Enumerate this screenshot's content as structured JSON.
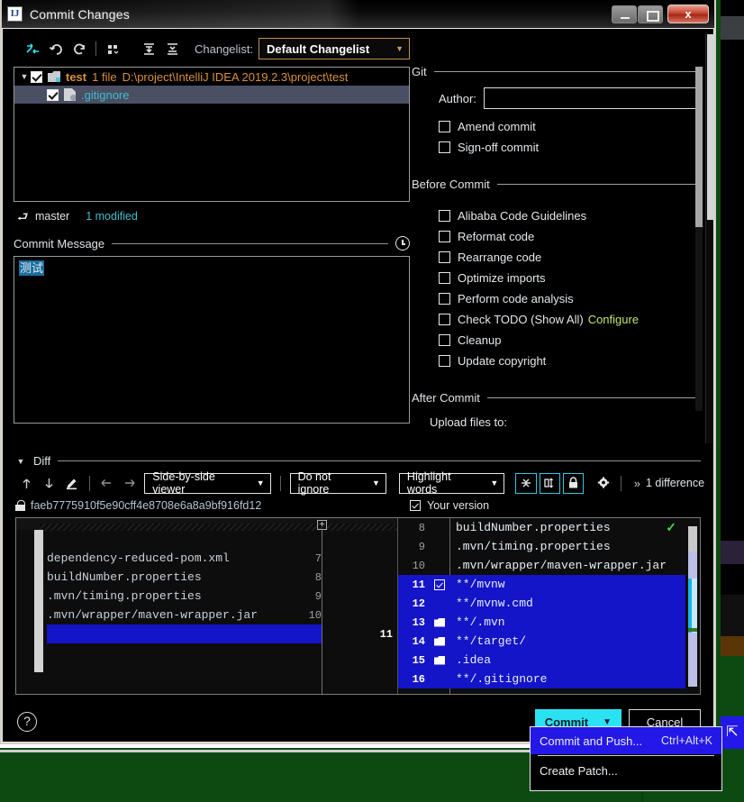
{
  "window": {
    "title": "Commit Changes",
    "app_icon": "IJ",
    "close_label": "x"
  },
  "changelist_toolbar": {
    "icons": [
      {
        "name": "move-to-another-changelist-icon",
        "glyph": "arrows"
      },
      {
        "name": "revert-icon",
        "glyph": "undo"
      },
      {
        "name": "refresh-icon",
        "glyph": "refresh"
      },
      {
        "name": "group-by-icon",
        "glyph": "group"
      },
      {
        "name": "expand-all-icon",
        "glyph": "expand"
      },
      {
        "name": "collapse-all-icon",
        "glyph": "collapse"
      }
    ],
    "changelist_label": "Changelist:",
    "changelist_value": "Default Changelist"
  },
  "file_tree": {
    "rows": [
      {
        "type": "folder",
        "expanded": true,
        "checked": true,
        "name": "test",
        "count": "1 file",
        "path": "D:\\project\\IntelliJ IDEA 2019.2.3\\project\\test",
        "selected": false
      },
      {
        "type": "file",
        "checked": true,
        "name": ".gitignore",
        "selected": true
      }
    ]
  },
  "branch_bar": {
    "branch": "master",
    "modified": "1 modified"
  },
  "commit_message": {
    "section_title": "Commit Message",
    "value": "测试",
    "history_icon": "clock-icon"
  },
  "git_group": {
    "title": "Git",
    "author_label": "Author:",
    "author_value": "",
    "options": [
      {
        "label": "Amend commit",
        "checked": false
      },
      {
        "label": "Sign-off commit",
        "checked": false
      }
    ]
  },
  "before_commit_group": {
    "title": "Before Commit",
    "options": [
      {
        "label": "Alibaba Code Guidelines",
        "checked": false
      },
      {
        "label": "Reformat code",
        "checked": false
      },
      {
        "label": "Rearrange code",
        "checked": false
      },
      {
        "label": "Optimize imports",
        "checked": false
      },
      {
        "label": "Perform code analysis",
        "checked": false
      },
      {
        "label": "Check TODO (Show All)",
        "checked": false,
        "link": "Configure"
      },
      {
        "label": "Cleanup",
        "checked": false
      },
      {
        "label": "Update copyright",
        "checked": false
      }
    ]
  },
  "after_commit_group": {
    "title": "After Commit",
    "upload_label": "Upload files to:"
  },
  "diff": {
    "section_title": "Diff",
    "viewer_mode": "Side-by-side viewer",
    "ignore_mode": "Do not ignore",
    "highlight_mode": "Highlight words",
    "difference_count": "1 difference",
    "chevrons": "»",
    "revision_hash": "faeb7775910f5e90cff4e8708e6a8a9bf916fd12",
    "your_version_label": "Your version",
    "your_version_checked": true,
    "left_lines": [
      {
        "num": "7",
        "text": "dependency-reduced-pom.xml",
        "highlight": false
      },
      {
        "num": "8",
        "text": "buildNumber.properties",
        "highlight": false
      },
      {
        "num": "9",
        "text": ".mvn/timing.properties",
        "highlight": false
      },
      {
        "num": "10",
        "text": ".mvn/wrapper/maven-wrapper.jar",
        "highlight": false
      },
      {
        "num": "11",
        "text": "",
        "highlight": true
      }
    ],
    "left_top_num": "8",
    "right_lines": [
      {
        "num": "8",
        "text": "buildNumber.properties",
        "highlight": false,
        "icon": ""
      },
      {
        "num": "9",
        "text": ".mvn/timing.properties",
        "highlight": false,
        "icon": ""
      },
      {
        "num": "10",
        "text": ".mvn/wrapper/maven-wrapper.jar",
        "highlight": false,
        "icon": ""
      },
      {
        "num": "11",
        "text": "**/mvnw",
        "highlight": true,
        "icon": "check"
      },
      {
        "num": "12",
        "text": "**/mvnw.cmd",
        "highlight": true,
        "icon": ""
      },
      {
        "num": "13",
        "text": "**/.mvn",
        "highlight": true,
        "icon": "folder"
      },
      {
        "num": "14",
        "text": "**/target/",
        "highlight": true,
        "icon": "folder"
      },
      {
        "num": "15",
        "text": ".idea",
        "highlight": true,
        "icon": "folder"
      },
      {
        "num": "16",
        "text": "**/.gitignore",
        "highlight": true,
        "icon": ""
      }
    ]
  },
  "bottom_bar": {
    "help_label": "?",
    "commit_label": "Commit",
    "commit_caret": "▼",
    "cancel_label": "Cancel"
  },
  "popup_menu": {
    "items": [
      {
        "label": "Commit and Push...",
        "shortcut": "Ctrl+Alt+K",
        "highlighted": true
      },
      {
        "label": "Create Patch...",
        "shortcut": "",
        "highlighted": false
      }
    ]
  },
  "colors": {
    "accent_cyan": "#2ae2f2",
    "selection_blue": "#1414c8",
    "menu_highlight": "#2418e8",
    "path_orange": "#d98f3a",
    "file_cyan": "#3fbccd",
    "link_green": "#c6e26a",
    "desktop_green": "#0d4a12"
  }
}
